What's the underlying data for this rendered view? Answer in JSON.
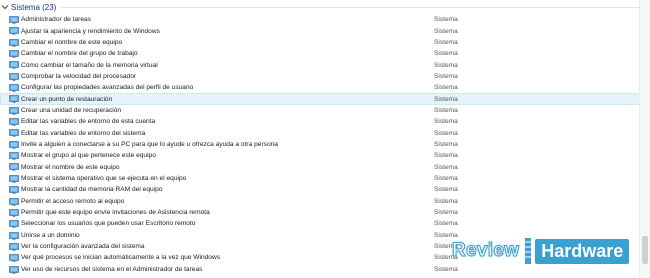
{
  "group": {
    "title": "Sistema (23)"
  },
  "items": [
    {
      "name": "Administrador de tareas",
      "category": "Sistema"
    },
    {
      "name": "Ajustar la apariencia y rendimiento de Windows",
      "category": "Sistema"
    },
    {
      "name": "Cambiar el nombre de este equipo",
      "category": "Sistema"
    },
    {
      "name": "Cambiar el nombre del grupo de trabajo",
      "category": "Sistema"
    },
    {
      "name": "Cómo cambiar el tamaño de la memoria virtual",
      "category": "Sistema"
    },
    {
      "name": "Comprobar la velocidad del procesador",
      "category": "Sistema"
    },
    {
      "name": "Configurar las propiedades avanzadas del perfil de usuario",
      "category": "Sistema"
    },
    {
      "name": "Crear un punto de restauración",
      "category": "Sistema",
      "selected": true
    },
    {
      "name": "Crear una unidad de recuperación",
      "category": "Sistema"
    },
    {
      "name": "Editar las variables de entorno de esta cuenta",
      "category": "Sistema"
    },
    {
      "name": "Editar las variables de entorno del sistema",
      "category": "Sistema"
    },
    {
      "name": "Invite a alguien a conectarse a su PC para que lo ayude u ofrezca ayuda a otra persona",
      "category": "Sistema"
    },
    {
      "name": "Mostrar el grupo al que pertenece este equipo",
      "category": "Sistema"
    },
    {
      "name": "Mostrar el nombre de este equipo",
      "category": "Sistema"
    },
    {
      "name": "Mostrar el sistema operativo que se ejecuta en el equipo",
      "category": "Sistema"
    },
    {
      "name": "Mostrar la cantidad de memoria RAM del equipo",
      "category": "Sistema"
    },
    {
      "name": "Permitir el acceso remoto al equipo",
      "category": "Sistema"
    },
    {
      "name": "Permitir que este equipo envíe invitaciones de Asistencia remota",
      "category": "Sistema"
    },
    {
      "name": "Seleccionar los usuarios que pueden usar Escritorio remoto",
      "category": "Sistema"
    },
    {
      "name": "Unirse a un dominio",
      "category": "Sistema"
    },
    {
      "name": "Ver la configuración avanzada del sistema",
      "category": "Sistema"
    },
    {
      "name": "Ver qué procesos se inician automáticamente a la vez que Windows",
      "category": "Sistema"
    },
    {
      "name": "Ver uso de recursos del sistema en el Administrador de tareas",
      "category": "Sistema"
    }
  ],
  "watermark": {
    "left": "Review",
    "right": "Hardware"
  },
  "colors": {
    "header": "#1e3287",
    "selected_bg": "#e5f3fb",
    "watermark": "#3aa0cf"
  }
}
